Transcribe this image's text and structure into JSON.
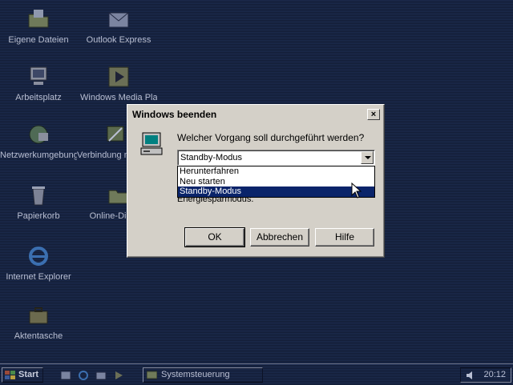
{
  "desktop": {
    "icons": [
      {
        "label": "Eigene Dateien",
        "icon": "folder-icon"
      },
      {
        "label": "Outlook Express",
        "icon": "outlook-icon"
      },
      {
        "label": "Arbeitsplatz",
        "icon": "computer-icon"
      },
      {
        "label": "Windows Media Player",
        "icon": "media-player-icon"
      },
      {
        "label": "Netzwerkumgebung",
        "icon": "network-icon"
      },
      {
        "label": "Verbindung mit dem Internet herstellen",
        "icon": "connection-icon"
      },
      {
        "label": "Papierkorb",
        "icon": "recycle-bin-icon"
      },
      {
        "label": "Online-Dienste",
        "icon": "online-services-icon"
      },
      {
        "label": "Internet Explorer",
        "icon": "ie-icon"
      },
      {
        "label": "Aktentasche",
        "icon": "briefcase-icon"
      }
    ]
  },
  "dialog": {
    "title": "Windows beenden",
    "close_symbol": "×",
    "prompt": "Welcher Vorgang soll durchgeführt werden?",
    "selected": "Standby-Modus",
    "options": [
      "Herunterfahren",
      "Neu starten",
      "Standby-Modus"
    ],
    "description": "Energiesparmodus.",
    "buttons": {
      "ok": "OK",
      "cancel": "Abbrechen",
      "help": "Hilfe"
    }
  },
  "taskbar": {
    "start_label": "Start",
    "task_label": "Systemsteuerung",
    "clock": "20:12"
  },
  "colors": {
    "desktop": "#1c2b4f",
    "dialog_face": "#d4d0c8",
    "selection": "#0a246a"
  }
}
